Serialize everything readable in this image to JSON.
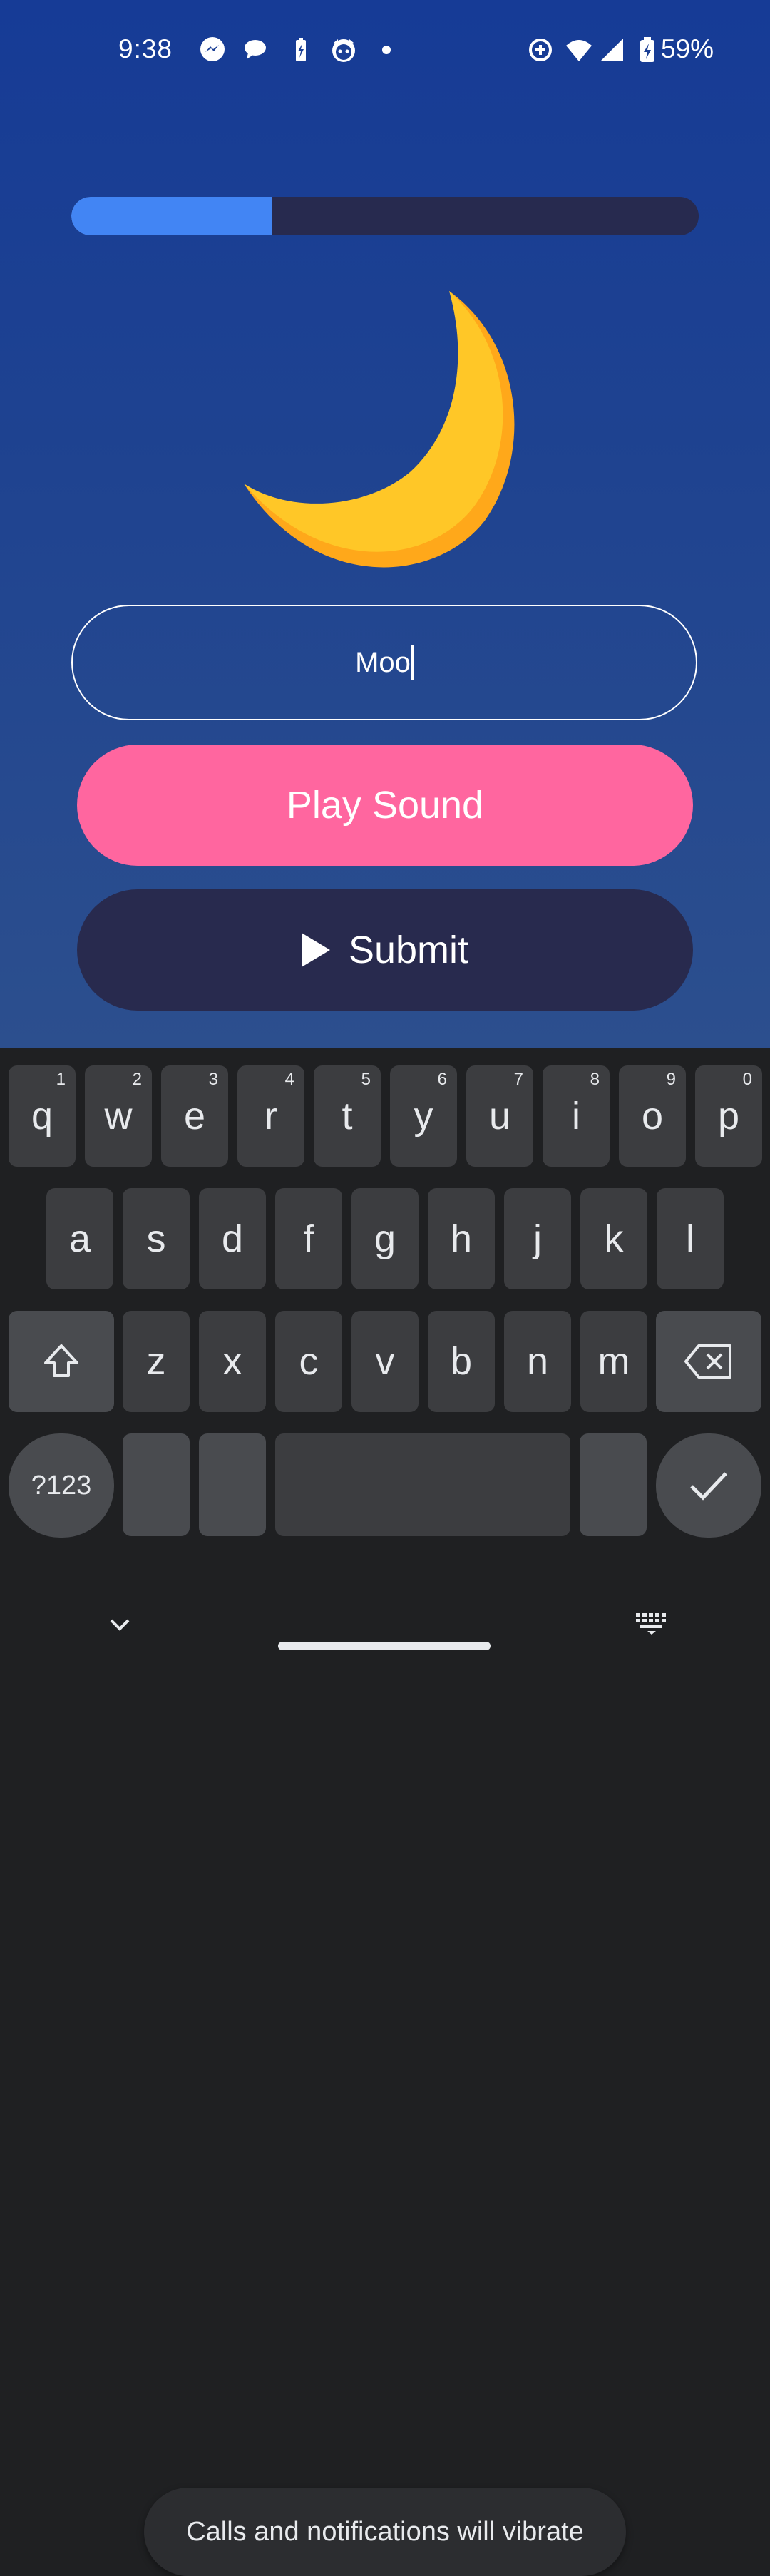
{
  "status_bar": {
    "time": "9:38",
    "battery_text": "59%"
  },
  "progress": {
    "value": 0.32
  },
  "answer_input": {
    "value": "Moo"
  },
  "buttons": {
    "play_sound": "Play Sound",
    "submit": "Submit"
  },
  "keyboard": {
    "row1": [
      {
        "k": "q",
        "n": "1"
      },
      {
        "k": "w",
        "n": "2"
      },
      {
        "k": "e",
        "n": "3"
      },
      {
        "k": "r",
        "n": "4"
      },
      {
        "k": "t",
        "n": "5"
      },
      {
        "k": "y",
        "n": "6"
      },
      {
        "k": "u",
        "n": "7"
      },
      {
        "k": "i",
        "n": "8"
      },
      {
        "k": "o",
        "n": "9"
      },
      {
        "k": "p",
        "n": "0"
      }
    ],
    "row2": [
      "a",
      "s",
      "d",
      "f",
      "g",
      "h",
      "j",
      "k",
      "l"
    ],
    "row3": [
      "z",
      "x",
      "c",
      "v",
      "b",
      "n",
      "m"
    ],
    "symbols_label": "?123"
  },
  "toast": {
    "text": "Calls and notifications will vibrate"
  },
  "colors": {
    "accent_blue": "#4285f4",
    "play_button": "#ff669f",
    "submit_button": "#282a4e",
    "moon": "#ffc727"
  }
}
